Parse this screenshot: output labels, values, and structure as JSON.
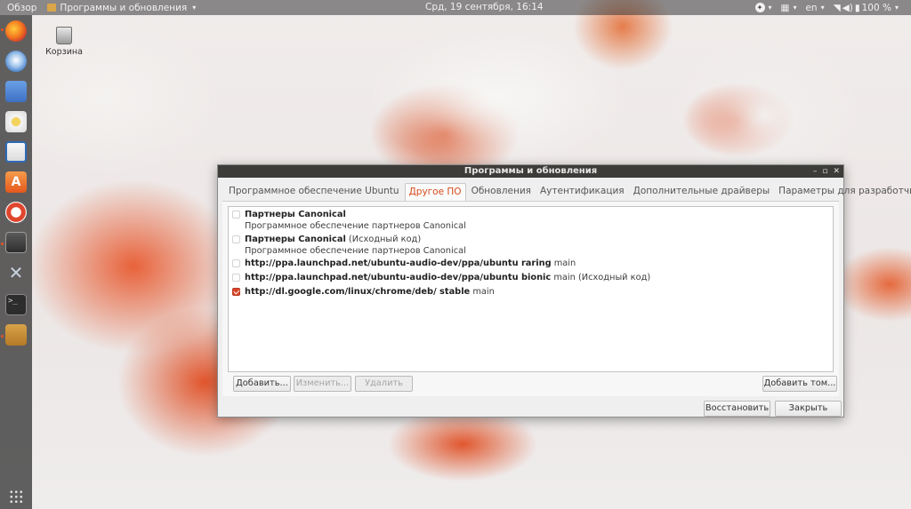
{
  "topbar": {
    "activities": "Обзор",
    "app_name": "Программы и обновления",
    "clock": "Срд, 19 сентября, 16:14",
    "language": "en",
    "battery": "100 %"
  },
  "desktop": {
    "trash_label": "Корзина"
  },
  "dock": {
    "items": [
      "firefox-icon",
      "thunderbird-icon",
      "files-icon",
      "rhythmbox-icon",
      "writer-icon",
      "software-center-icon",
      "help-icon",
      "software-updater-icon",
      "tools-icon",
      "terminal-icon",
      "network-files-icon"
    ],
    "terminal_glyph": ">_"
  },
  "window": {
    "title": "Программы и обновления",
    "tabs": [
      {
        "label": "Программное обеспечение Ubuntu",
        "active": false
      },
      {
        "label": "Другое ПО",
        "active": true
      },
      {
        "label": "Обновления",
        "active": false
      },
      {
        "label": "Аутентификация",
        "active": false
      },
      {
        "label": "Дополнительные драйверы",
        "active": false
      },
      {
        "label": "Параметры для разработчиков",
        "active": false
      }
    ],
    "sources": [
      {
        "title": "Партнеры Canonical",
        "suffix": "",
        "description": "Программное обеспечение партнеров Canonical",
        "checked": false
      },
      {
        "title": "Партнеры Canonical",
        "suffix": " (Исходный код)",
        "description": "Программное обеспечение партнеров Canonical",
        "checked": false
      },
      {
        "title": "http://ppa.launchpad.net/ubuntu-audio-dev/ppa/ubuntu raring",
        "suffix": " main",
        "description": "",
        "checked": false
      },
      {
        "title": "http://ppa.launchpad.net/ubuntu-audio-dev/ppa/ubuntu bionic",
        "suffix": " main (Исходный код)",
        "description": "",
        "checked": false
      },
      {
        "title": "http://dl.google.com/linux/chrome/deb/ stable",
        "suffix": " main",
        "description": "",
        "checked": true
      }
    ],
    "buttons": {
      "add": "Добавить...",
      "edit": "Изменить...",
      "remove": "Удалить",
      "add_volume": "Добавить том...",
      "revert": "Восстановить",
      "close": "Закрыть"
    },
    "controls": {
      "minimize": "–",
      "maximize": "▫",
      "close": "✕"
    }
  },
  "colors": {
    "accent": "#d64a1c",
    "checkbox_checked": "#d9472a",
    "titlebar": "#3d3c39"
  }
}
